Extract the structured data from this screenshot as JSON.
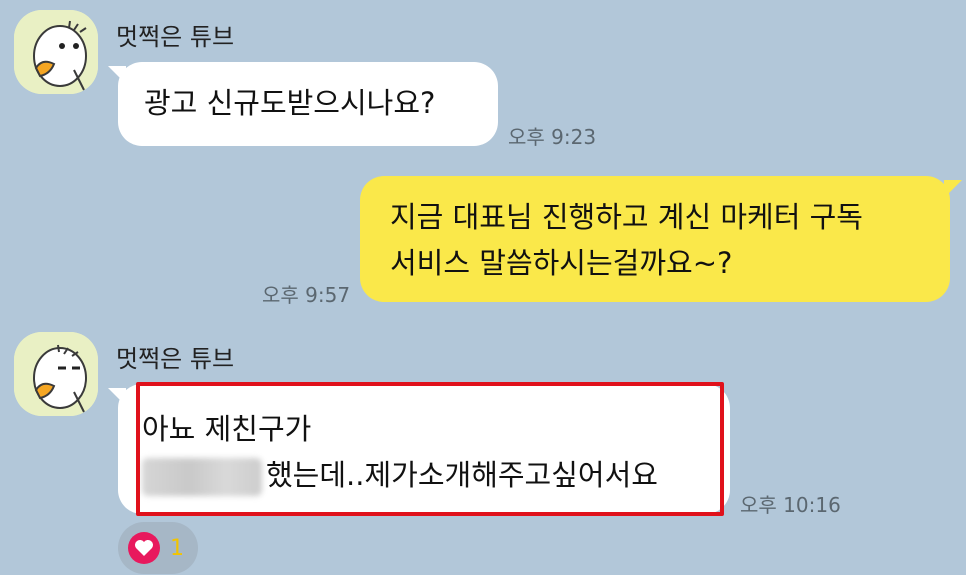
{
  "messages": [
    {
      "sender": "멋쩍은 튜브",
      "text": "광고 신규도받으시나요?",
      "time": "오후 9:23"
    },
    {
      "line1": "지금 대표님 진행하고 계신 마케터 구독",
      "line2": "서비스 말씀하시는걸까요~?",
      "time": "오후 9:57"
    },
    {
      "sender": "멋쩍은 튜브",
      "line1": "아뇨 제친구가",
      "line2_suffix": "했는데..제가소개해주고싶어서요",
      "time": "오후 10:16",
      "reaction_count": "1"
    }
  ],
  "colors": {
    "background": "#b2c7d9",
    "incoming_bubble": "#ffffff",
    "outgoing_bubble": "#fae84a",
    "highlight": "#e0111b",
    "reaction_heart": "#e8195d"
  },
  "icons": {
    "avatar": "duck-character-avatar",
    "reaction": "heart-icon"
  }
}
